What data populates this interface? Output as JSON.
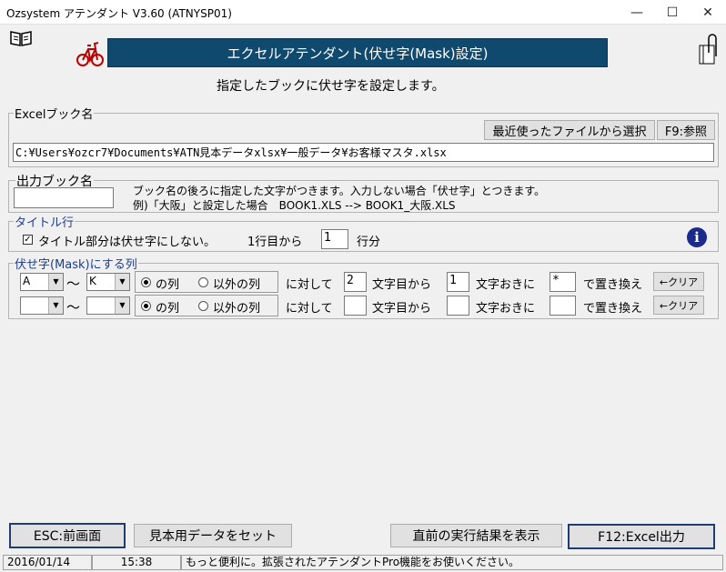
{
  "window": {
    "title": "Ozsystem アテンダント V3.60 (ATNYSP01)"
  },
  "header": {
    "banner": "エクセルアテンダント(伏せ字(Mask)設定)",
    "description": "指定したブックに伏せ字を設定します。"
  },
  "excel_book": {
    "label": "Excelブック名",
    "recent_button": "最近使ったファイルから選択",
    "browse_button": "F9:参照",
    "path": "C:¥Users¥ozcr7¥Documents¥ATN見本データxlsx¥一般データ¥お客様マスタ.xlsx"
  },
  "output_book": {
    "label": "出力ブック名",
    "value": "",
    "hint1": "ブック名の後ろに指定した文字がつきます。入力しない場合「伏せ字」とつきます。",
    "hint2": "例)「大阪」と設定した場合　BOOK1.XLS --> BOOK1_大阪.XLS"
  },
  "title_row": {
    "label": "タイトル行",
    "checkbox_label": "タイトル部分は伏せ字にしない。",
    "row_prefix": "1行目から",
    "row_value": "1",
    "row_suffix": "行分"
  },
  "mask": {
    "label": "伏せ字(Mask)にする列",
    "tilde": "～",
    "radio_col": "の列",
    "radio_other": "以外の列",
    "for_text": "に対して",
    "from_text": "文字目から",
    "every_text": "文字おきに",
    "replace_text": "で置き換え",
    "clear_label": "←クリア",
    "rows": [
      {
        "from_col": "A",
        "to_col": "K",
        "start": "2",
        "interval": "1",
        "char": "*"
      },
      {
        "from_col": "",
        "to_col": "",
        "start": "",
        "interval": "",
        "char": ""
      }
    ]
  },
  "footer": {
    "esc_button": "ESC:前画面",
    "sample_button": "見本用データをセット",
    "last_result_button": "直前の実行結果を表示",
    "output_button": "F12:Excel出力"
  },
  "status": {
    "date": "2016/01/14",
    "time": "15:38",
    "message": "もっと便利に。拡張されたアテンダントPro機能をお使いください。"
  },
  "colors": {
    "banner_bg": "#0f4a6e",
    "banner_fg": "#ffffff",
    "info_icon": "#1a2b8c",
    "group_label": "#1c3c8c"
  }
}
